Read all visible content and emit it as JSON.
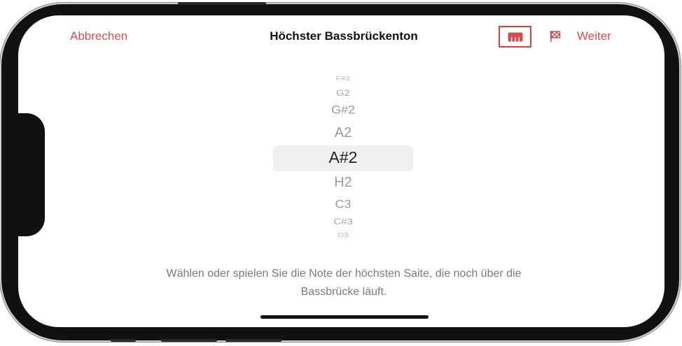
{
  "nav": {
    "cancel_label": "Abbrechen",
    "title": "Höchster Bassbrückenton",
    "next_label": "Weiter",
    "piano_icon": "piano-keyboard-icon",
    "flag_icon": "checkered-flag-icon"
  },
  "picker": {
    "notes": [
      "F#2",
      "G2",
      "G#2",
      "A2",
      "A#2",
      "H2",
      "C3",
      "C#3",
      "D3"
    ],
    "selected": "A#2"
  },
  "instruction": {
    "line1": "Wählen oder spielen Sie die Note der höchsten Saite, die noch über die",
    "line2": "Bassbrücke läuft."
  },
  "colors": {
    "accent": "#d14f4f",
    "highlight_border": "#d9403f"
  }
}
